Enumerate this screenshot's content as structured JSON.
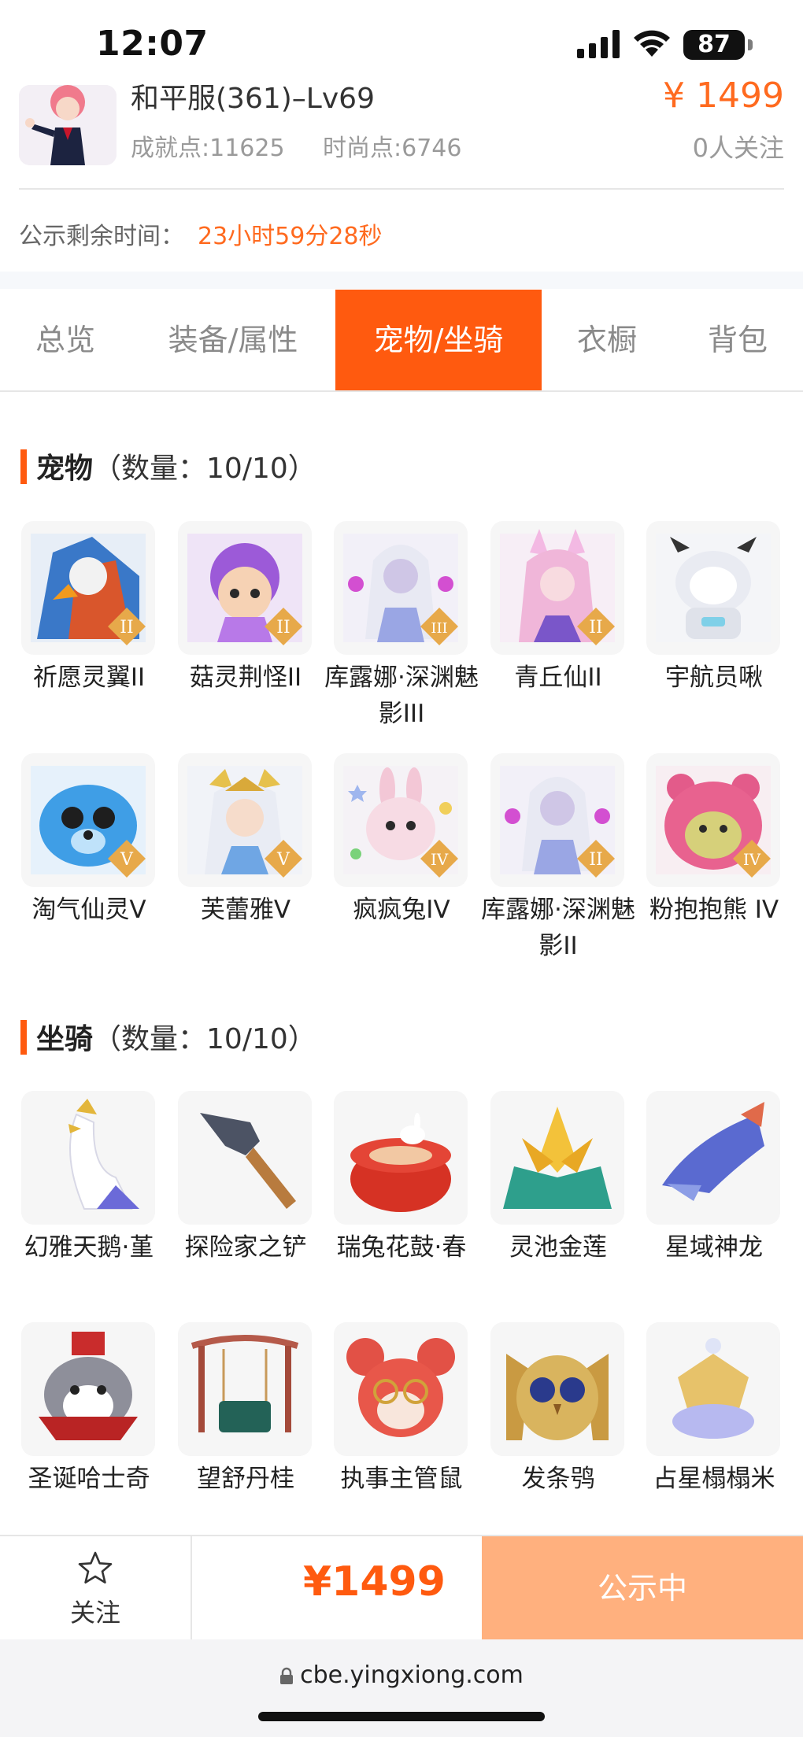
{
  "status_bar": {
    "time": "12:07",
    "battery": "87"
  },
  "header": {
    "server_title": "和平服(361)–Lv69",
    "achievement": "成就点:11625",
    "fashion": "时尚点:6746",
    "price": "¥ 1499",
    "followers": "0人关注",
    "notice_label": "公示剩余时间：",
    "notice_time": "23小时59分28秒"
  },
  "tabs": [
    {
      "label": "总览"
    },
    {
      "label": "装备/属性"
    },
    {
      "label": "宠物/坐骑",
      "active": true
    },
    {
      "label": "衣橱"
    },
    {
      "label": "背包"
    }
  ],
  "pets": {
    "title": "宠物",
    "count": "（数量：10/10）",
    "items": [
      {
        "name": "祈愿灵翼II",
        "icon": "griffin-pet-icon",
        "badge": "II"
      },
      {
        "name": "菇灵荆怪II",
        "icon": "mushroom-sprite-pet-icon",
        "badge": "II"
      },
      {
        "name": "库露娜·深渊魅影III",
        "icon": "abyss-maiden-pet-icon",
        "badge": "III"
      },
      {
        "name": "青丘仙II",
        "icon": "fox-fairy-pet-icon",
        "badge": "II"
      },
      {
        "name": "宇航员啾",
        "icon": "astronaut-cow-pet-icon",
        "badge": ""
      },
      {
        "name": "淘气仙灵V",
        "icon": "blue-puppy-pet-icon",
        "badge": "V"
      },
      {
        "name": "芙蕾雅V",
        "icon": "valkyrie-pet-icon",
        "badge": "V"
      },
      {
        "name": "疯疯兔IV",
        "icon": "crazy-rabbit-pet-icon",
        "badge": "IV"
      },
      {
        "name": "库露娜·深渊魅影II",
        "icon": "abyss-maiden-pet-icon",
        "badge": "II"
      },
      {
        "name": "粉抱抱熊 IV",
        "icon": "pink-bear-pet-icon",
        "badge": "IV"
      }
    ]
  },
  "mounts": {
    "title": "坐骑",
    "count": "（数量：10/10）",
    "items": [
      {
        "name": "幻雅天鹅·堇",
        "icon": "swan-mount-icon"
      },
      {
        "name": "探险家之铲",
        "icon": "shovel-mount-icon"
      },
      {
        "name": "瑞兔花鼓·春",
        "icon": "rabbit-drum-mount-icon"
      },
      {
        "name": "灵池金莲",
        "icon": "golden-lotus-mount-icon"
      },
      {
        "name": "星域神龙",
        "icon": "star-dragon-mount-icon"
      },
      {
        "name": "圣诞哈士奇",
        "icon": "christmas-husky-mount-icon"
      },
      {
        "name": "望舒丹桂",
        "icon": "osmanthus-swing-mount-icon"
      },
      {
        "name": "执事主管鼠",
        "icon": "butler-mouse-mount-icon"
      },
      {
        "name": "发条鸮",
        "icon": "clockwork-owl-mount-icon"
      },
      {
        "name": "占星榻榻米",
        "icon": "astrology-tatami-mount-icon"
      }
    ]
  },
  "action_bar": {
    "follow_label": "关注",
    "price": "¥1499",
    "status_label": "公示中"
  },
  "url_bar": {
    "url": "cbe.yingxiong.com"
  },
  "colors": {
    "accent": "#ff5a0f",
    "price": "#ff6a1f",
    "status_button": "#ffb07e"
  }
}
